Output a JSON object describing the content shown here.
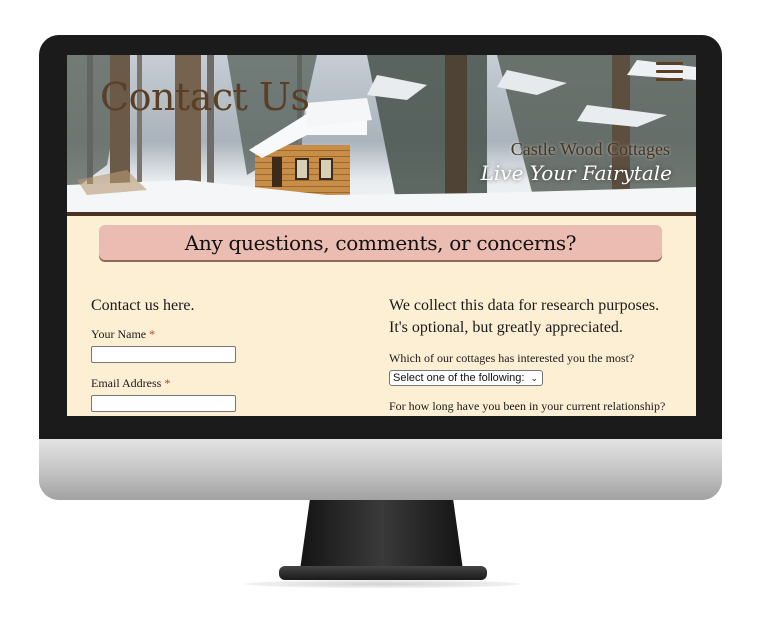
{
  "hero": {
    "title": "Contact Us",
    "brand_name": "Castle Wood Cottages",
    "tagline": "Live Your Fairytale",
    "menu_icon": "hamburger-menu-icon"
  },
  "banner": {
    "text": "Any questions, comments, or concerns?"
  },
  "contact_form": {
    "intro": "Contact us here.",
    "name_label": "Your Name",
    "email_label": "Email Address",
    "required_marker": "*"
  },
  "research_form": {
    "intro_line1": "We collect this data for research purposes.",
    "intro_line2": "It's optional, but greatly appreciated.",
    "cottage_question": "Which of our cottages has interested you the most?",
    "cottage_select_value": "Select one of the following:",
    "relationship_question": "For how long have you been in your current relationship?"
  },
  "colors": {
    "page_background": "#fdefd3",
    "banner_background": "#ebbcb1",
    "title_brown": "#5b3f25",
    "required_red": "#c0392b"
  }
}
